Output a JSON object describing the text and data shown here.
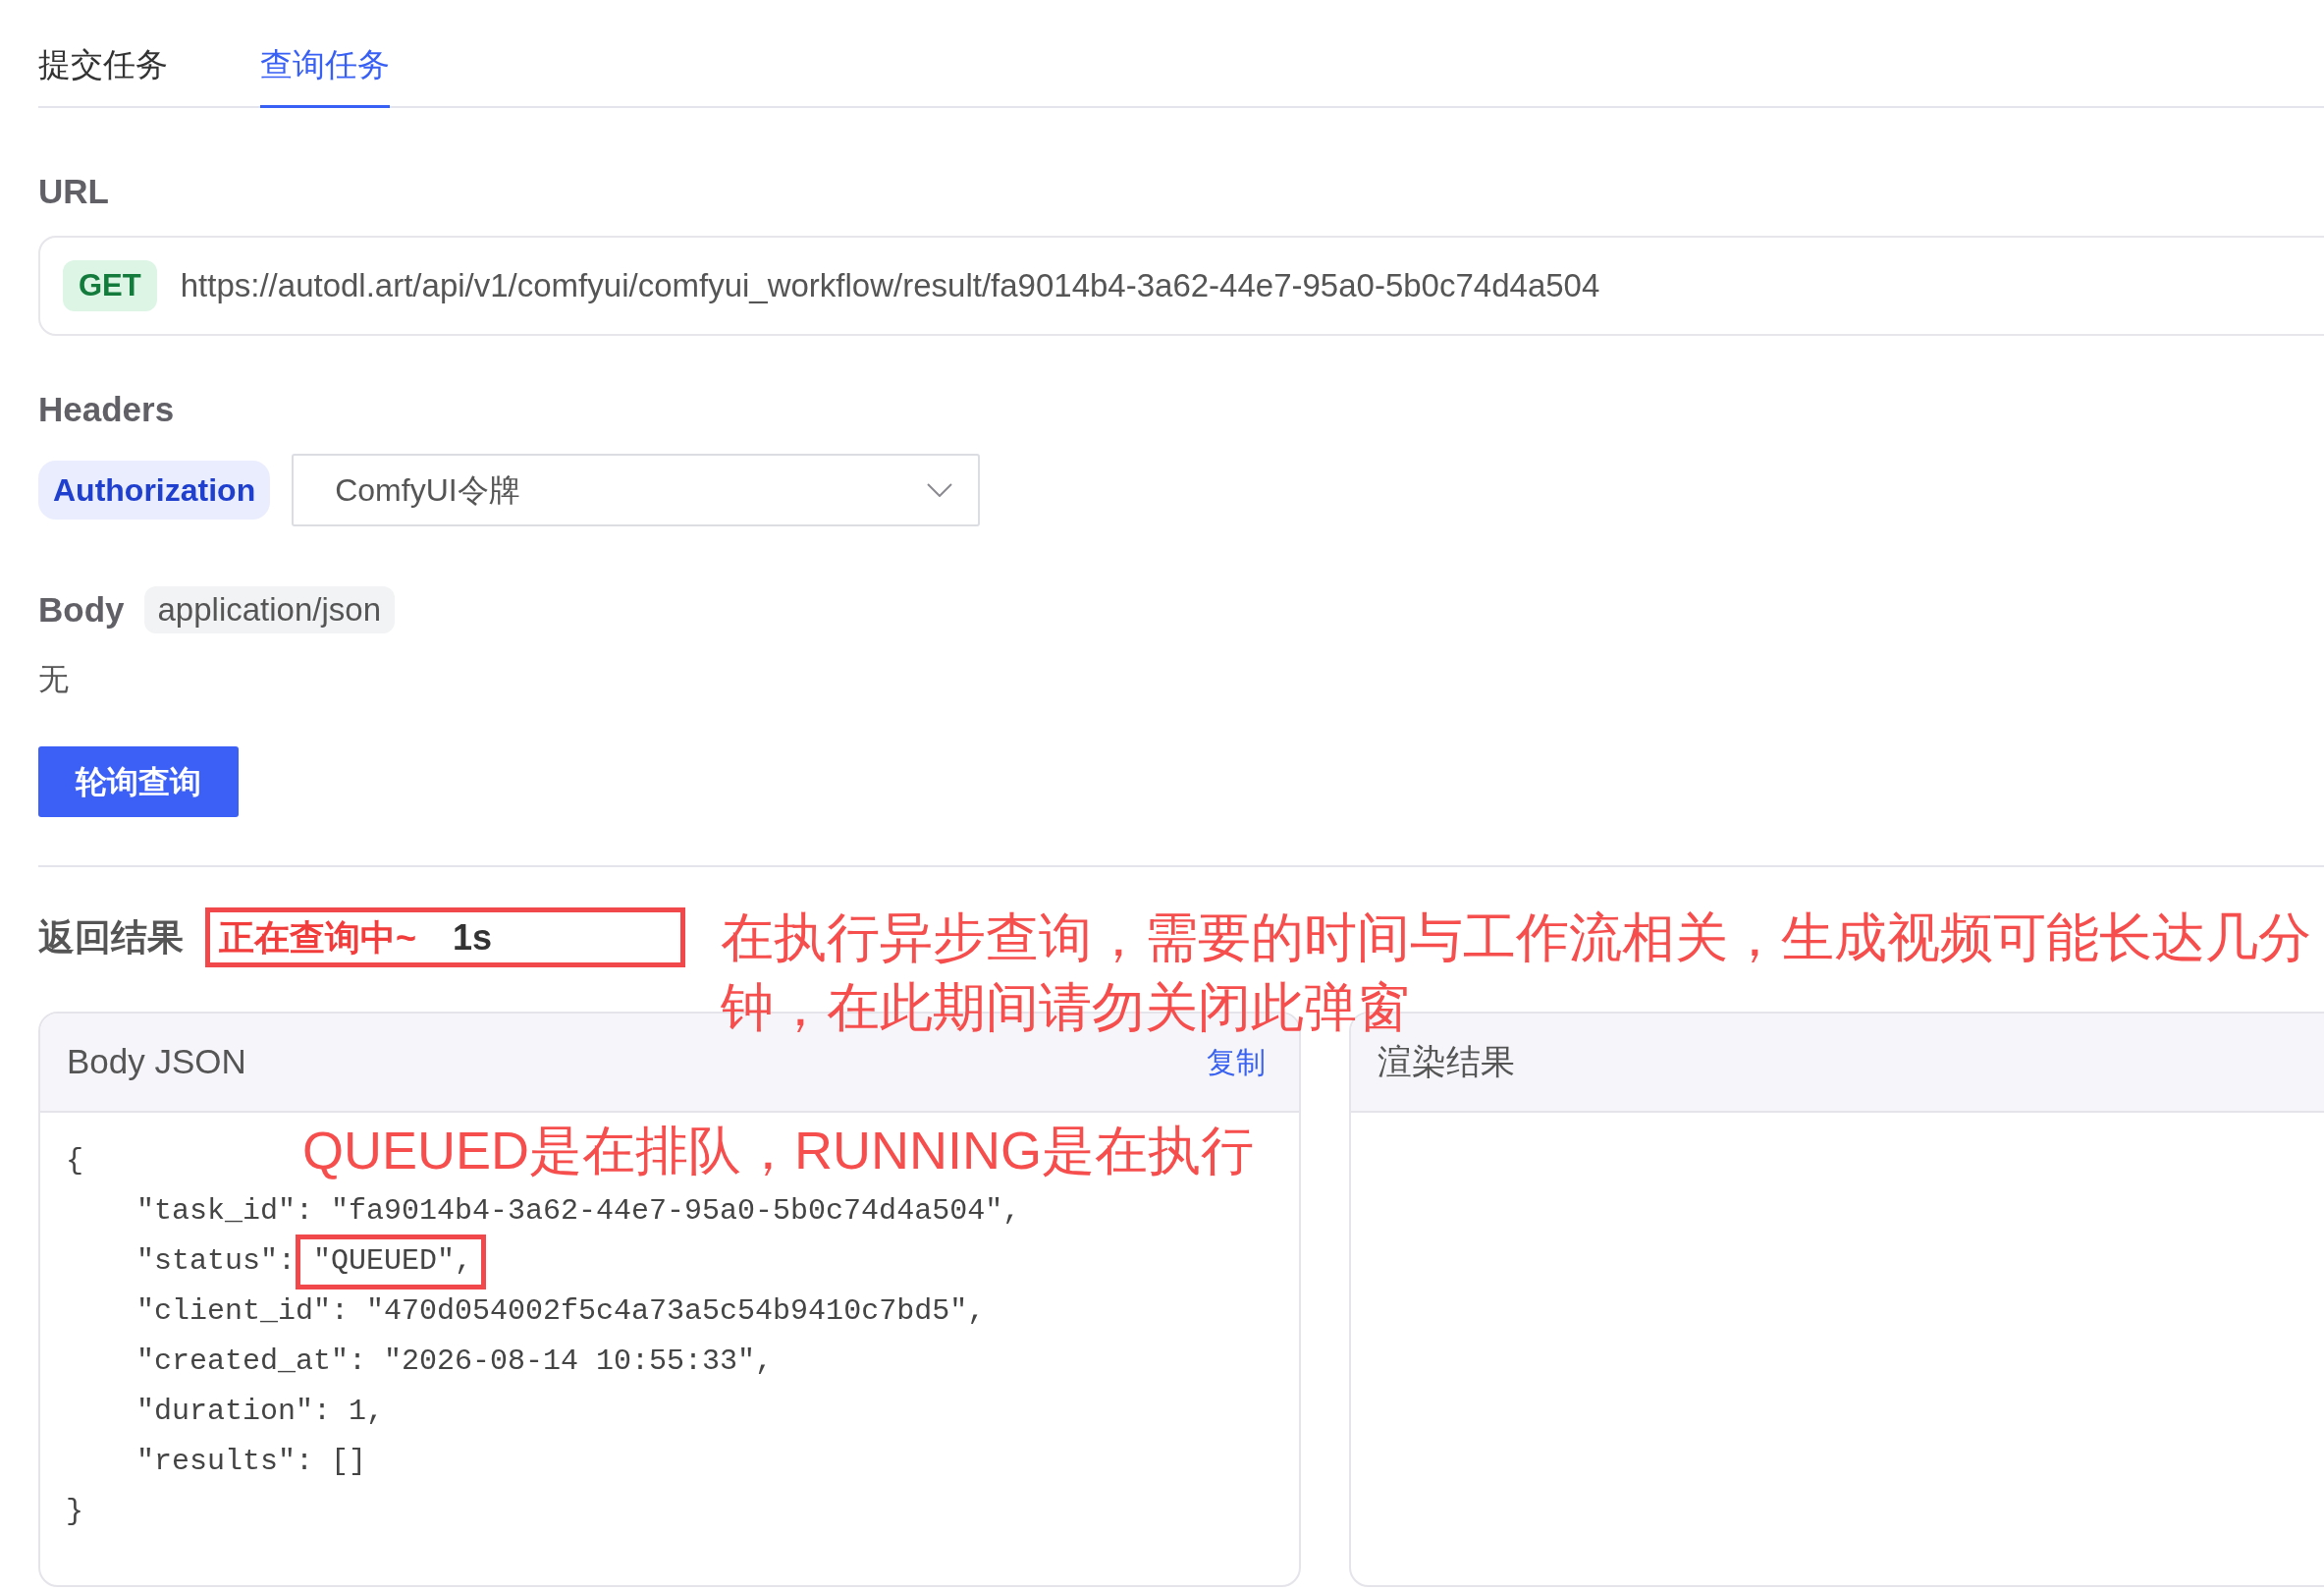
{
  "tabs": [
    {
      "label": "提交任务",
      "selected": false
    },
    {
      "label": "查询任务",
      "selected": true
    }
  ],
  "url_section": {
    "label": "URL",
    "method": "GET",
    "url": "https://autodl.art/api/v1/comfyui/comfyui_workflow/result/fa9014b4-3a62-44e7-95a0-5b0c74d4a504"
  },
  "headers_section": {
    "label": "Headers",
    "header_name": "Authorization",
    "select": {
      "value": "ComfyUI令牌"
    }
  },
  "body_section": {
    "label": "Body",
    "content_type": "application/json",
    "content": "无"
  },
  "poll_button": "轮询查询",
  "result": {
    "label": "返回结果",
    "status": "正在查询中~",
    "elapsed": "1s",
    "highlighted": true,
    "note": "在执行异步查询，需要的时间与工作流相关，生成视频可能长达几分钟，在此期间请勿关闭此弹窗"
  },
  "panels": [
    {
      "title": "Body JSON",
      "action": "复制",
      "note": "QUEUED是在排队，RUNNING是在执行",
      "lines": [
        {
          "kind": "brace",
          "text": "{"
        },
        {
          "kind": "entry",
          "key": "\"task_id\":",
          "value": "\"fa9014b4-3a62-44e7-95a0-5b0c74d4a504\",",
          "highlighted": false
        },
        {
          "kind": "entry",
          "key": "\"status\":",
          "value": "\"QUEUED\",",
          "highlighted": true
        },
        {
          "kind": "entry",
          "key": "\"client_id\":",
          "value": "\"470d054002f5c4a73a5c54b9410c7bd5\",",
          "highlighted": false
        },
        {
          "kind": "entry",
          "key": "\"created_at\":",
          "value": "\"2026-08-14 10:55:33\",",
          "highlighted": false
        },
        {
          "kind": "entry",
          "key": "\"duration\":",
          "value": "1,",
          "highlighted": false
        },
        {
          "kind": "entry",
          "key": "\"results\":",
          "value": "[]",
          "highlighted": false
        },
        {
          "kind": "brace",
          "text": "}"
        }
      ]
    },
    {
      "title": "渲染结果"
    }
  ]
}
